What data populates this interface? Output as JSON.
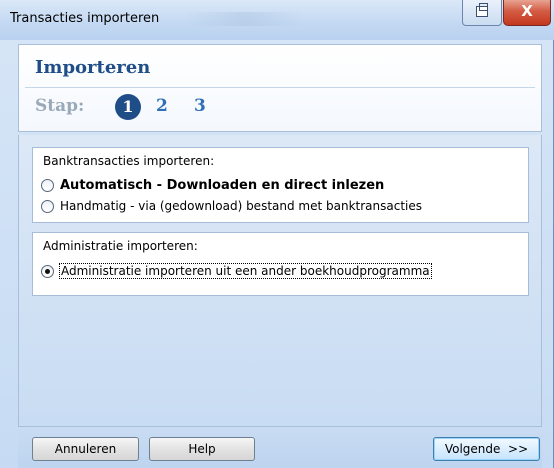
{
  "window": {
    "title": "Transacties importeren",
    "controls": {
      "restore_icon": "restore-icon",
      "close_glyph": "X"
    }
  },
  "header": {
    "title": "Importeren",
    "step_label": "Stap:",
    "steps": [
      "1",
      "2",
      "3"
    ],
    "active_step": "1"
  },
  "bank_group": {
    "heading": "Banktransacties importeren:",
    "options": [
      {
        "label": "Automatisch - Downloaden en direct inlezen",
        "checked": false
      },
      {
        "label": "Handmatig - via (gedownload) bestand met banktransacties",
        "checked": false
      }
    ]
  },
  "admin_group": {
    "heading": "Administratie importeren:",
    "options": [
      {
        "label": "Administratie importeren uit een ander boekhoudprogramma",
        "checked": true
      }
    ]
  },
  "footer": {
    "cancel_label": "Annuleren",
    "help_label": "Help",
    "next_label": "Volgende  >>"
  },
  "colors": {
    "accent": "#1f4d87",
    "step_inactive": "#2f6fb5",
    "step_label": "#9aa9b9",
    "close_button": "#c3381e"
  }
}
